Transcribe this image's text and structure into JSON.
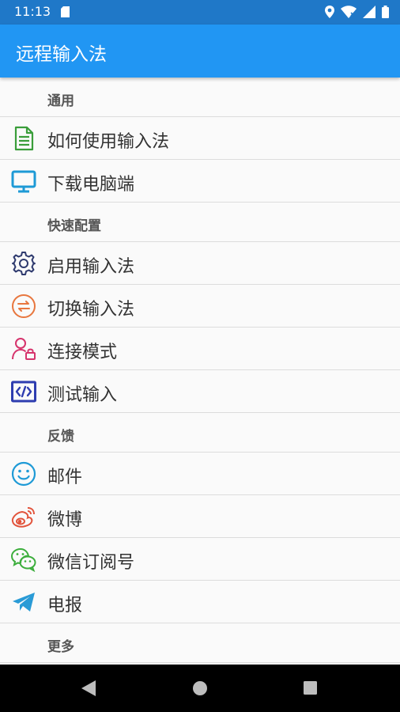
{
  "status": {
    "time": "11:13"
  },
  "app": {
    "title": "远程输入法"
  },
  "sections": {
    "general": "通用",
    "quick": "快速配置",
    "feedback": "反馈",
    "more": "更多"
  },
  "items": {
    "howto": "如何使用输入法",
    "download": "下载电脑端",
    "enable": "启用输入法",
    "switch": "切换输入法",
    "connect": "连接模式",
    "test": "测试输入",
    "mail": "邮件",
    "weibo": "微博",
    "wechat": "微信订阅号",
    "telegram": "电报"
  },
  "colors": {
    "statusbar": "#1f78c8",
    "appbar": "#2196f3",
    "howto_icon": "#3a9e3a",
    "download_icon": "#1e9ad6",
    "enable_icon": "#2e3a6e",
    "switch_icon": "#e8773f",
    "connect_icon": "#d6336c",
    "test_icon": "#2e3db0",
    "mail_icon": "#1e9ad6",
    "weibo_icon": "#e2543c",
    "wechat_icon": "#3cae3c",
    "telegram_icon": "#2a9bd6"
  },
  "icons": {
    "howto": "document-icon",
    "download": "monitor-icon",
    "enable": "gear-icon",
    "switch": "swap-icon",
    "connect": "user-lock-icon",
    "test": "code-icon",
    "mail": "smiley-icon",
    "weibo": "weibo-icon",
    "wechat": "wechat-icon",
    "telegram": "telegram-icon"
  }
}
